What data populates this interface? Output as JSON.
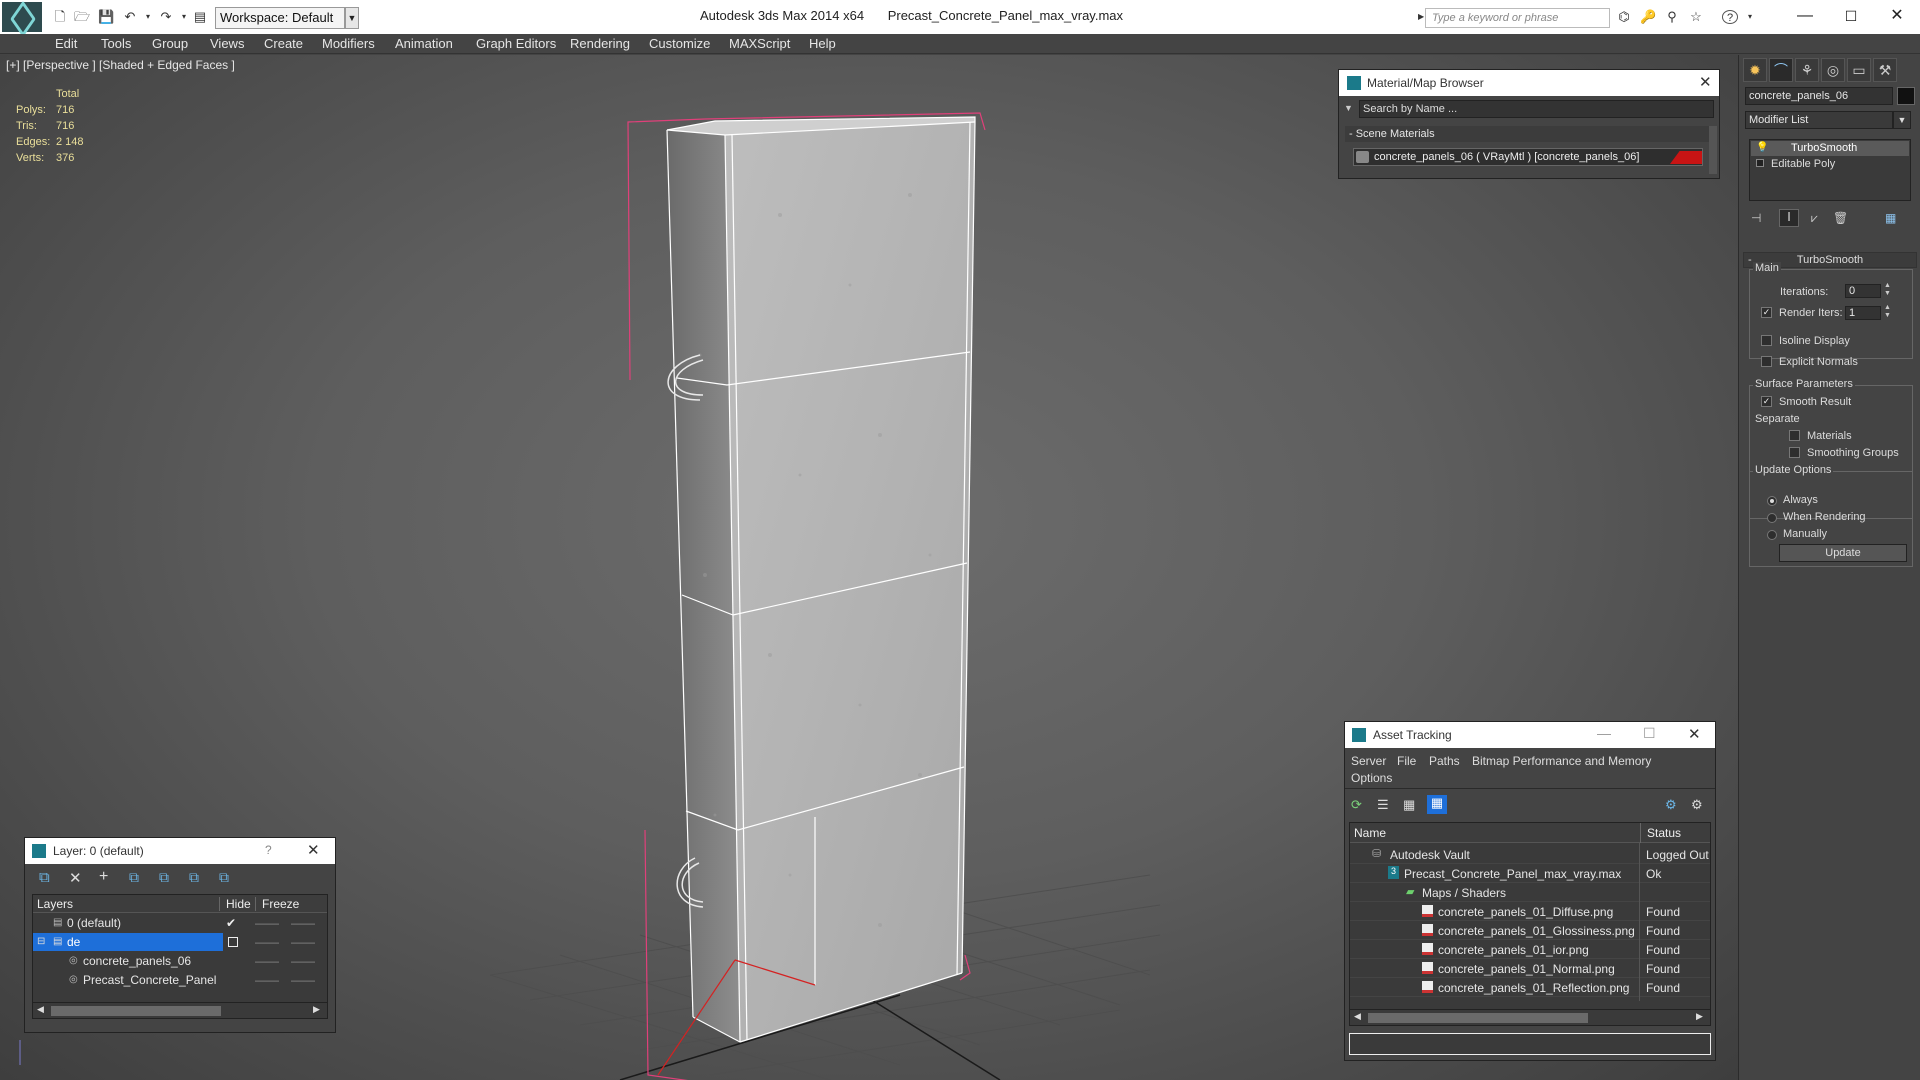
{
  "app": {
    "title": "Autodesk 3ds Max  2014 x64",
    "file": "Precast_Concrete_Panel_max_vray.max",
    "workspace": "Workspace: Default",
    "search_placeholder": "Type a keyword or phrase"
  },
  "menu": [
    "Edit",
    "Tools",
    "Group",
    "Views",
    "Create",
    "Modifiers",
    "Animation",
    "Graph Editors",
    "Rendering",
    "Customize",
    "MAXScript",
    "Help"
  ],
  "viewport": {
    "label": "[+] [Perspective ] [Shaded + Edged Faces ]",
    "stats_header": "Total",
    "stats": [
      {
        "label": "Polys:",
        "value": "716"
      },
      {
        "label": "Tris:",
        "value": "716"
      },
      {
        "label": "Edges:",
        "value": "2 148"
      },
      {
        "label": "Verts:",
        "value": "376"
      }
    ]
  },
  "material_browser": {
    "title": "Material/Map Browser",
    "search_placeholder": "Search by Name ...",
    "section": "- Scene Materials",
    "item": "concrete_panels_06  ( VRayMtl )  [concrete_panels_06]"
  },
  "command_panel": {
    "object_name": "concrete_panels_06",
    "modifier_list": "Modifier List",
    "stack": [
      "TurboSmooth",
      "Editable Poly"
    ],
    "rollout_title": "TurboSmooth",
    "main_group": "Main",
    "iterations_label": "Iterations:",
    "iterations_value": "0",
    "render_iters_label": "Render Iters:",
    "render_iters_value": "1",
    "isoline_label": "Isoline Display",
    "explicit_normals_label": "Explicit Normals",
    "surface_group": "Surface Parameters",
    "smooth_result_label": "Smooth Result",
    "separate_label": "Separate",
    "materials_label": "Materials",
    "smoothing_groups_label": "Smoothing Groups",
    "update_group": "Update Options",
    "update_options": [
      "Always",
      "When Rendering",
      "Manually"
    ],
    "update_button": "Update"
  },
  "layer_window": {
    "title": "Layer: 0 (default)",
    "help": "?",
    "col_layers": "Layers",
    "col_hide": "Hide",
    "col_freeze": "Freeze",
    "rows": [
      {
        "name": "0 (default)",
        "indent": 1
      },
      {
        "name": "de",
        "indent": 0
      },
      {
        "name": "concrete_panels_06",
        "indent": 2
      },
      {
        "name": "Precast_Concrete_Panel",
        "indent": 2
      }
    ]
  },
  "asset_tracking": {
    "title": "Asset Tracking",
    "menu": [
      "Server",
      "File",
      "Paths",
      "Bitmap Performance and Memory",
      "Options"
    ],
    "col_name": "Name",
    "col_status": "Status",
    "rows": [
      {
        "name": "Autodesk Vault",
        "status": "Logged Out",
        "indent": 1
      },
      {
        "name": "Precast_Concrete_Panel_max_vray.max",
        "status": "Ok",
        "indent": 2
      },
      {
        "name": "Maps / Shaders",
        "status": "",
        "indent": 3
      },
      {
        "name": "concrete_panels_01_Diffuse.png",
        "status": "Found",
        "indent": 4
      },
      {
        "name": "concrete_panels_01_Glossiness.png",
        "status": "Found",
        "indent": 4
      },
      {
        "name": "concrete_panels_01_ior.png",
        "status": "Found",
        "indent": 4
      },
      {
        "name": "concrete_panels_01_Normal.png",
        "status": "Found",
        "indent": 4
      },
      {
        "name": "concrete_panels_01_Reflection.png",
        "status": "Found",
        "indent": 4
      }
    ]
  },
  "colors": {
    "accent": "#1e6fd9",
    "stats_text": "#eadf9a",
    "material_swatch": "#c81414",
    "selection_outline": "#e0407a"
  }
}
